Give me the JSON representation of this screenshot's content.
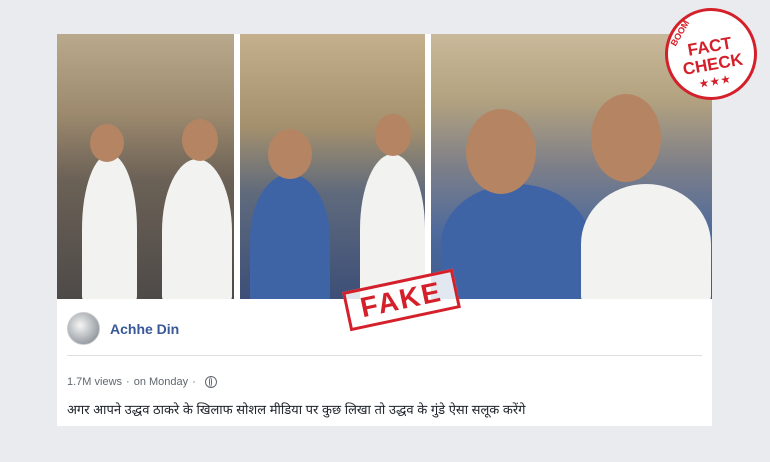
{
  "post": {
    "author": "Achhe Din",
    "views": "1.7M views",
    "separator": "·",
    "time": "on Monday",
    "caption": "अगर आपने उद्धव ठाकरे के खिलाफ सोशल मीडिया पर कुछ लिखा तो उद्धव के गुंडे ऐसा सलूक करेंगे"
  },
  "overlays": {
    "fake_stamp": "FAKE",
    "badge": {
      "brand": "BOOM",
      "line1": "FACT",
      "line2": "CHECK",
      "stars": "★★★"
    }
  },
  "colors": {
    "stamp_red": "#d4202a",
    "author_blue": "#385898",
    "background": "#e9ebee"
  },
  "icons": [
    "globe-icon"
  ]
}
